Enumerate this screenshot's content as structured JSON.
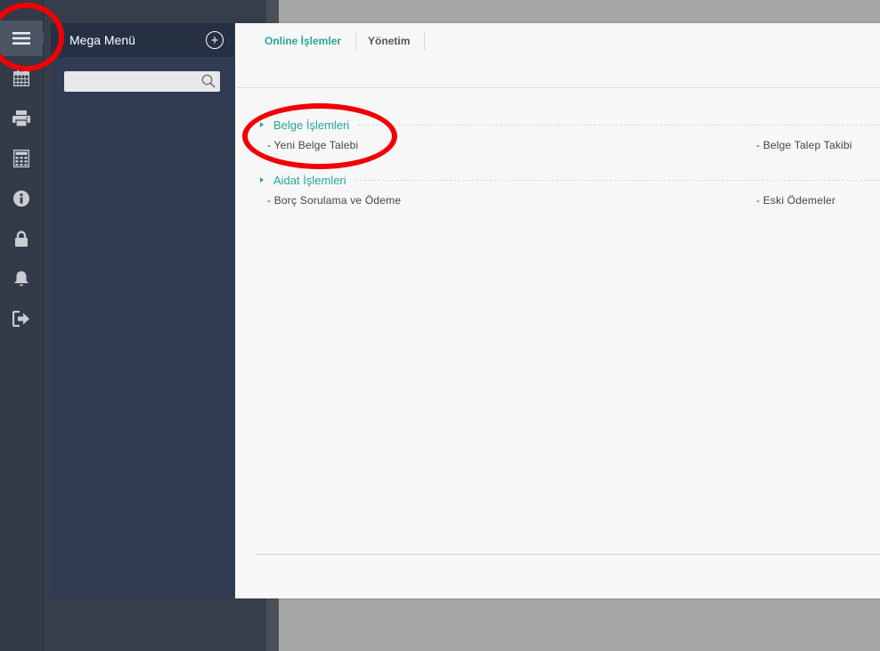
{
  "rail": {
    "items": [
      {
        "icon": "hamburger-icon"
      },
      {
        "icon": "calendar-icon"
      },
      {
        "icon": "printer-icon"
      },
      {
        "icon": "calculator-icon"
      },
      {
        "icon": "info-icon"
      },
      {
        "icon": "lock-icon"
      },
      {
        "icon": "bell-icon"
      },
      {
        "icon": "logout-icon"
      }
    ]
  },
  "mega_menu": {
    "title": "Mega Menü",
    "add_symbol": "+",
    "search_placeholder": ""
  },
  "tabs": [
    {
      "label": "Online İşlemler",
      "active": true
    },
    {
      "label": "Yönetim",
      "active": false
    }
  ],
  "sections": [
    {
      "title": "Belge İşlemleri",
      "items": [
        "- Yeni Belge Talebi",
        "- Belge Talep Takibi"
      ]
    },
    {
      "title": "Aidat İşlemleri",
      "items": [
        "- Borç Sorulama ve Ödeme",
        "- Eski Ödemeler"
      ]
    }
  ],
  "colors": {
    "accent": "#2aa593",
    "annotation": "#f00000",
    "rail": "#333b48",
    "panel": "#313c52"
  }
}
